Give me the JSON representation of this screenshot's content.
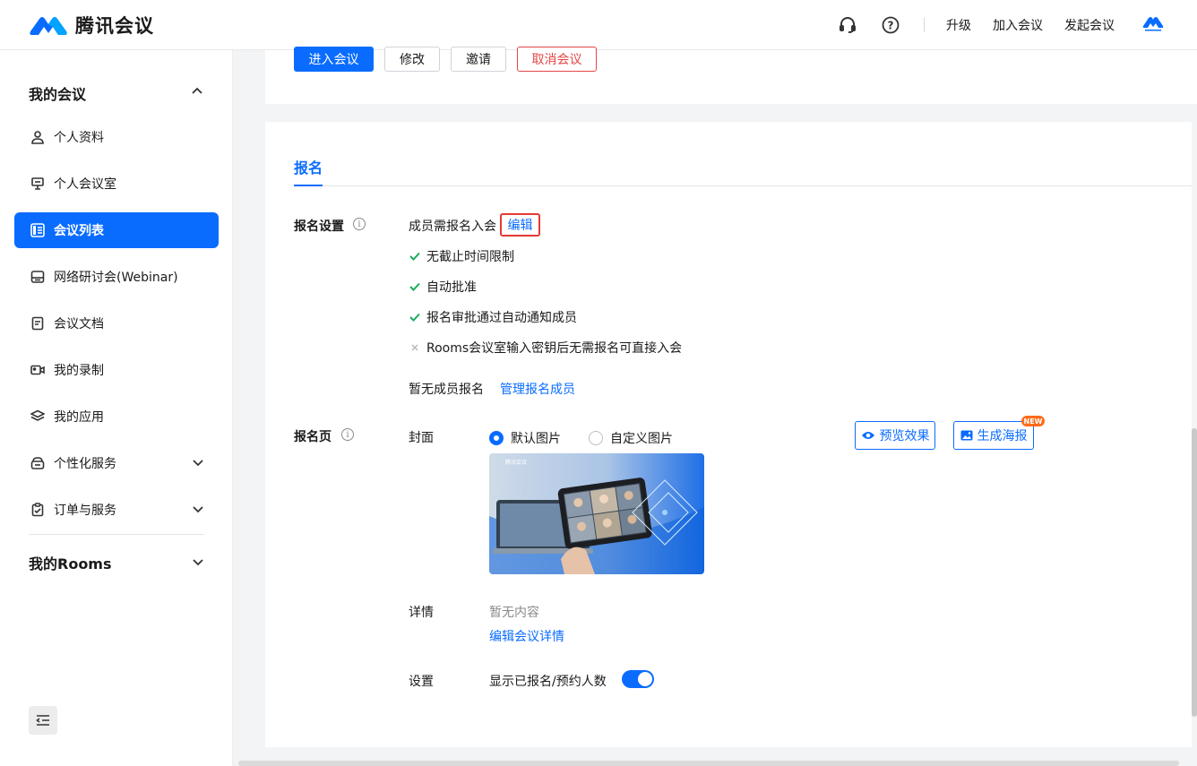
{
  "app": {
    "name": "腾讯会议"
  },
  "header": {
    "upgrade": "升级",
    "join_meeting": "加入会议",
    "start_meeting": "发起会议"
  },
  "sidebar": {
    "group_my_meetings": "我的会议",
    "items": [
      {
        "label": "个人资料",
        "icon": "user-icon"
      },
      {
        "label": "个人会议室",
        "icon": "podium-icon"
      },
      {
        "label": "会议列表",
        "icon": "list-icon",
        "active": true
      },
      {
        "label": "网络研讨会(Webinar)",
        "icon": "webinar-icon"
      },
      {
        "label": "会议文档",
        "icon": "document-icon"
      },
      {
        "label": "我的录制",
        "icon": "video-icon"
      },
      {
        "label": "我的应用",
        "icon": "layers-icon"
      },
      {
        "label": "个性化服务",
        "icon": "service-icon"
      },
      {
        "label": "订单与服务",
        "icon": "clipboard-icon"
      }
    ],
    "group_my_rooms": "我的Rooms"
  },
  "actions": {
    "enter": "进入会议",
    "modify": "修改",
    "invite": "邀请",
    "cancel": "取消会议"
  },
  "registration": {
    "tab": "报名",
    "settings_label": "报名设置",
    "requirement": "成员需报名入会",
    "edit": "编辑",
    "options": [
      {
        "text": "无截止时间限制",
        "enabled": true
      },
      {
        "text": "自动批准",
        "enabled": true
      },
      {
        "text": "报名审批通过自动通知成员",
        "enabled": true
      },
      {
        "text": "Rooms会议室输入密钥后无需报名可直接入会",
        "enabled": false
      }
    ],
    "no_members": "暂无成员报名",
    "manage_members": "管理报名成员",
    "page_label": "报名页",
    "cover_label": "封面",
    "cover_default": "默认图片",
    "cover_custom": "自定义图片",
    "cover_selected": "默认图片",
    "preview": "预览效果",
    "poster": "生成海报",
    "new_badge": "NEW",
    "details_label": "详情",
    "details_empty": "暂无内容",
    "edit_details": "编辑会议详情",
    "setting_label": "设置",
    "show_count": "显示已报名/预约人数",
    "show_count_on": true
  },
  "colors": {
    "primary": "#0a6cff",
    "danger": "#e54545",
    "success": "#1aad5c"
  }
}
